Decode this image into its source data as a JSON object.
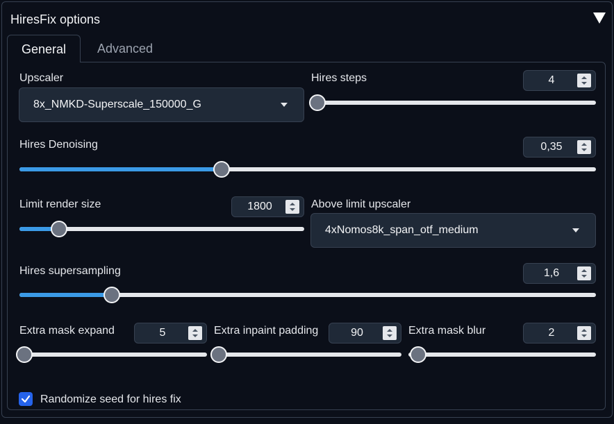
{
  "panel": {
    "title": "HiresFix options"
  },
  "tabs": [
    {
      "label": "General"
    },
    {
      "label": "Advanced"
    }
  ],
  "general": {
    "upscaler": {
      "label": "Upscaler",
      "value": "8x_NMKD-Superscale_150000_G"
    },
    "hires_steps": {
      "label": "Hires steps",
      "value": "4",
      "slider_fraction": 0.0
    },
    "hires_denoising": {
      "label": "Hires Denoising",
      "value": "0,35",
      "slider_fraction": 0.35
    },
    "limit_render_size": {
      "label": "Limit render size",
      "value": "1800",
      "slider_fraction": 0.14
    },
    "above_limit_upscaler": {
      "label": "Above limit upscaler",
      "value": "4xNomos8k_span_otf_medium"
    },
    "hires_supersampling": {
      "label": "Hires supersampling",
      "value": "1,6",
      "slider_fraction": 0.16
    },
    "extra_mask_expand": {
      "label": "Extra mask expand",
      "value": "5",
      "slider_fraction": 0.0
    },
    "extra_inpaint_padding": {
      "label": "Extra inpaint padding",
      "value": "90",
      "slider_fraction": 0.0
    },
    "extra_mask_blur": {
      "label": "Extra mask blur",
      "value": "2",
      "slider_fraction": 0.0
    },
    "randomize_seed": {
      "label": "Randomize seed for hires fix",
      "checked": true
    }
  },
  "colors": {
    "accent": "#3b9ae6",
    "checkbox": "#2563eb",
    "background": "#0b0f19",
    "field": "#1f2937"
  },
  "icons": {
    "collapse": "triangle-down-icon",
    "dropdown": "caret-down-icon",
    "spinner": "up-down-arrows-icon",
    "check": "check-icon"
  }
}
